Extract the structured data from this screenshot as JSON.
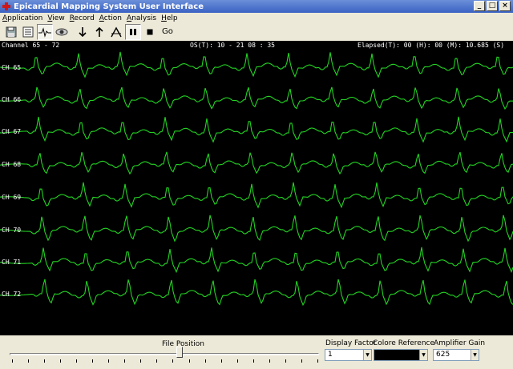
{
  "window": {
    "title": "Epicardial Mapping System User Interface",
    "controls": [
      "_",
      "□",
      "×"
    ]
  },
  "menu": [
    {
      "label": "Application"
    },
    {
      "label": "View"
    },
    {
      "label": "Record"
    },
    {
      "label": "Action"
    },
    {
      "label": "Analysis"
    },
    {
      "label": "Help"
    }
  ],
  "toolbar": {
    "icons": [
      "save-icon",
      "list-icon",
      "waveform-icon",
      "eye-icon",
      "arrow-down-icon",
      "arrow-up-icon",
      "peak-detect-icon",
      "pause-icon",
      "stop-icon"
    ],
    "go_label": "Go"
  },
  "scope": {
    "channel_range": "Channel 65 - 72",
    "os_time": "OS(T): 10 - 21  08 : 35",
    "elapsed": "Elapsed(T): 00 (H): 00 (M): 10.685 (S)",
    "trace_color": "#22d422",
    "background": "#000000",
    "channels": [
      "CH 65",
      "CH 66",
      "CH 67",
      "CH 68",
      "CH 69",
      "CH 70",
      "CH 71",
      "CH 72"
    ]
  },
  "controls": {
    "file_position_label": "File Position",
    "file_position_value": 0.55,
    "display_factor_label": "Display Factor",
    "display_factor_value": "1",
    "color_reference_label": "Colore Reference",
    "color_reference_value": "",
    "amplifier_gain_label": "Amplifier Gain",
    "amplifier_gain_value": "625"
  }
}
